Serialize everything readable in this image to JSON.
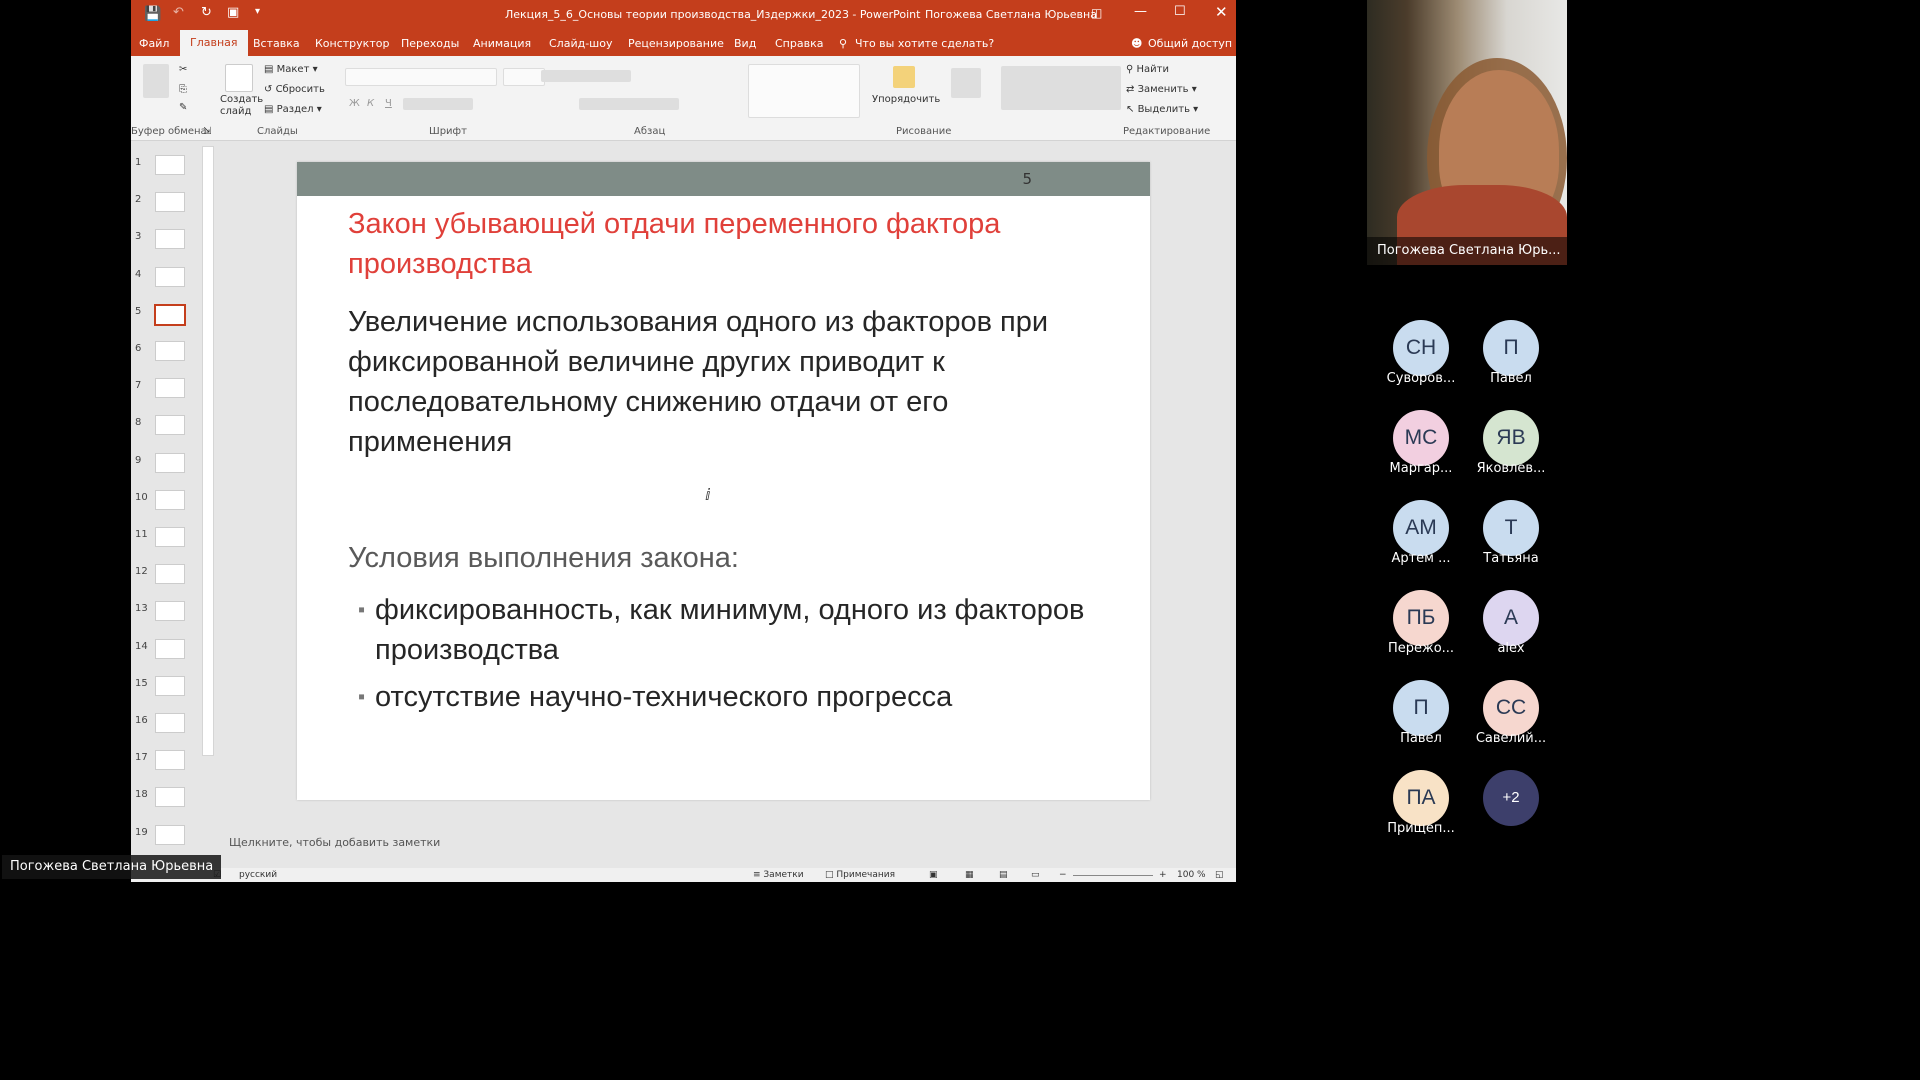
{
  "app": {
    "title": "Лекция_5_6_Основы теории производства_Издержки_2023  -  PowerPoint",
    "user": "Погожева Светлана Юрьевна",
    "menu": [
      "Файл",
      "Главная",
      "Вставка",
      "Конструктор",
      "Переходы",
      "Анимация",
      "Слайд-шоу",
      "Рецензирование",
      "Вид",
      "Справка"
    ],
    "tell_me": "Что вы хотите сделать?",
    "share": "Общий доступ"
  },
  "ribbon": {
    "groups": [
      "Буфер обмена",
      "Слайды",
      "Шрифт",
      "Абзац",
      "Рисование",
      "Редактирование"
    ],
    "slides": {
      "layout": "Макет",
      "reset": "Сбросить",
      "section": "Раздел",
      "new_slide": "Создать слайд"
    },
    "arrange": "Упорядочить",
    "editing": {
      "find": "Найти",
      "replace": "Заменить",
      "select": "Выделить"
    }
  },
  "thumbnails": {
    "numbers": [
      "1",
      "2",
      "3",
      "4",
      "5",
      "6",
      "7",
      "8",
      "9",
      "10",
      "11",
      "12",
      "13",
      "14",
      "15",
      "16",
      "17",
      "18",
      "19"
    ],
    "selected": "5"
  },
  "slide": {
    "number": "5",
    "title": "Закон убывающей отдачи переменного фактора производства",
    "body": "Увеличение использования одного из факторов при фиксированной величине других приводит к последовательному снижению отдачи от его применения",
    "conditions_heading": "Условия выполнения закона:",
    "bullets": [
      "фиксированность, как минимум, одного из факторов производства",
      "отсутствие научно-технического прогресса"
    ]
  },
  "notes_placeholder": "Щелкните, чтобы добавить заметки",
  "statusbar": {
    "language": "русский",
    "notes": "Заметки",
    "comments": "Примечания",
    "zoom": "100 %"
  },
  "video": {
    "name": "Погожева Светлана Юрь..."
  },
  "participants": [
    {
      "initials": "СН",
      "name": "Суворов...",
      "color": "#c9dcef"
    },
    {
      "initials": "П",
      "name": "Павел",
      "color": "#c9dcef"
    },
    {
      "initials": "МС",
      "name": "Маргар...",
      "color": "#f2cfe0"
    },
    {
      "initials": "ЯВ",
      "name": "Яковлев...",
      "color": "#d5e5d0"
    },
    {
      "initials": "АМ",
      "name": "Артем ...",
      "color": "#c9dcef"
    },
    {
      "initials": "Т",
      "name": "Татьяна",
      "color": "#c9dcef"
    },
    {
      "initials": "ПБ",
      "name": "Пережо...",
      "color": "#f6d7cf"
    },
    {
      "initials": "А",
      "name": "alex",
      "color": "#ddd6f0"
    },
    {
      "initials": "П",
      "name": "Павел",
      "color": "#c9dcef"
    },
    {
      "initials": "СС",
      "name": "Савелий...",
      "color": "#f6d7cf"
    },
    {
      "initials": "ПА",
      "name": "Прищеп...",
      "color": "#f8e2c6"
    }
  ],
  "more_participants": "+2",
  "presenter": "Погожева Светлана Юрьевна"
}
